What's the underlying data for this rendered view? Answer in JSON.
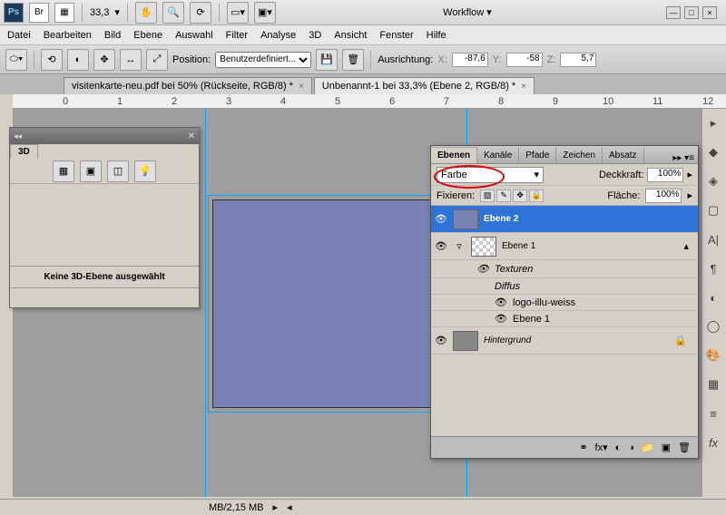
{
  "app": {
    "zoom": "33,3",
    "workflow": "Workflow ▾"
  },
  "menu": [
    "Datei",
    "Bearbeiten",
    "Bild",
    "Ebene",
    "Auswahl",
    "Filter",
    "Analyse",
    "3D",
    "Ansicht",
    "Fenster",
    "Hilfe"
  ],
  "options": {
    "position_label": "Position:",
    "position_value": "Benutzerdefiniert...",
    "ausrichtung": "Ausrichtung:",
    "x": "-87,6",
    "y": "-58",
    "z": "5,7"
  },
  "tabs": [
    "visitenkarte-neu.pdf bei 50% (Rückseite, RGB/8) *",
    "Unbenannt-1 bei 33,3% (Ebene 2, RGB/8) *"
  ],
  "ruler": [
    "0",
    "1",
    "2",
    "3",
    "4",
    "5",
    "6",
    "7",
    "8",
    "9",
    "10",
    "11",
    "12"
  ],
  "panel3d": {
    "title": "3D",
    "message": "Keine 3D-Ebene ausgewählt"
  },
  "layers": {
    "tabs": [
      "Ebenen",
      "Kanäle",
      "Pfade",
      "Zeichen",
      "Absatz"
    ],
    "blend": "Farbe",
    "deckkraft_label": "Deckkraft:",
    "deckkraft": "100%",
    "fixieren_label": "Fixieren:",
    "flaeche_label": "Fläche:",
    "flaeche": "100%",
    "items": {
      "ebene2": "Ebene 2",
      "ebene1": "Ebene 1",
      "texturen": "Texturen",
      "diffus": "Diffus",
      "logo": "logo-illu-weiss",
      "ebene1b": "Ebene 1",
      "hintergrund": "Hintergrund"
    }
  },
  "status": {
    "mem": "MB/2,15 MB"
  }
}
